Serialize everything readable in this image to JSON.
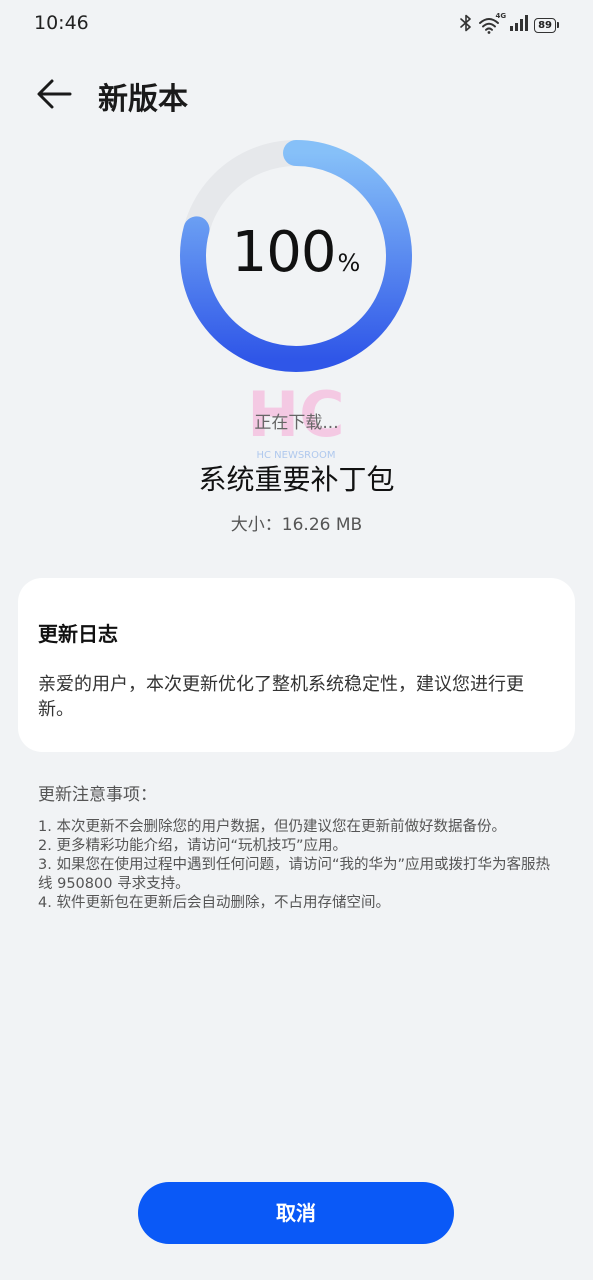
{
  "status_bar": {
    "time": "10:46",
    "network_label": "4G",
    "battery": "89",
    "icons": [
      "bluetooth-icon",
      "wifi-icon",
      "signal-icon",
      "battery-icon"
    ]
  },
  "header": {
    "title": "新版本",
    "back_icon": "arrow-left-icon"
  },
  "progress": {
    "value": "100",
    "unit": "%",
    "fraction": 1.0,
    "track_color": "#e6e8eb",
    "gradient_start": "#86c0f8",
    "gradient_end": "#2f56e8"
  },
  "watermark": {
    "logo_text": "HC",
    "sub_text": "HC NEWSROOM"
  },
  "download_status": "正在下载...",
  "package": {
    "name": "系统重要补丁包",
    "size": "大小：16.26 MB"
  },
  "changelog": {
    "title": "更新日志",
    "body": "亲爱的用户，本次更新优化了整机系统稳定性，建议您进行更新。"
  },
  "notes": {
    "title": "更新注意事项：",
    "items": [
      "1. 本次更新不会删除您的用户数据，但仍建议您在更新前做好数据备份。",
      "2. 更多精彩功能介绍，请访问“玩机技巧”应用。",
      "3. 如果您在使用过程中遇到任何问题，请访问“我的华为”应用或拨打华为客服热线 950800 寻求支持。",
      "4. 软件更新包在更新后会自动删除，不占用存储空间。"
    ]
  },
  "cancel_button": {
    "label": "取消",
    "color": "#0a59f7"
  }
}
